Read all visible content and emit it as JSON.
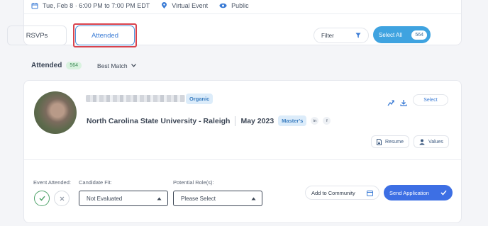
{
  "event": {
    "datetime": "Tue, Feb 8 · 6:00 PM to 7:00 PM EDT",
    "location": "Virtual Event",
    "visibility": "Public"
  },
  "tabs": {
    "rsvps": "RSVPs",
    "attended": "Attended"
  },
  "toolbar": {
    "filter_label": "Filter",
    "select_all_label": "Select All",
    "select_all_count": "564"
  },
  "list_header": {
    "label": "Attended",
    "count": "564",
    "sort": "Best Match"
  },
  "candidate": {
    "source_tag": "Organic",
    "school": "North Carolina State University - Raleigh",
    "grad_date": "May 2023",
    "degree": "Master's",
    "social_1": "in",
    "social_2": "f",
    "select_label": "Select",
    "resume_label": "Resume",
    "values_label": "Values"
  },
  "evaluation": {
    "event_attended_label": "Event Attended:",
    "candidate_fit_label": "Candidate Fit:",
    "candidate_fit_value": "Not Evaluated",
    "potential_roles_label": "Potential Role(s):",
    "potential_roles_value": "Please Select",
    "add_to_community_label": "Add to Community",
    "send_application_label": "Send Application"
  },
  "colors": {
    "accent_blue": "#3d6fe4",
    "select_all_blue": "#3fa3e0",
    "highlight_red": "#d9424c",
    "attended_green": "#4fa36a"
  }
}
